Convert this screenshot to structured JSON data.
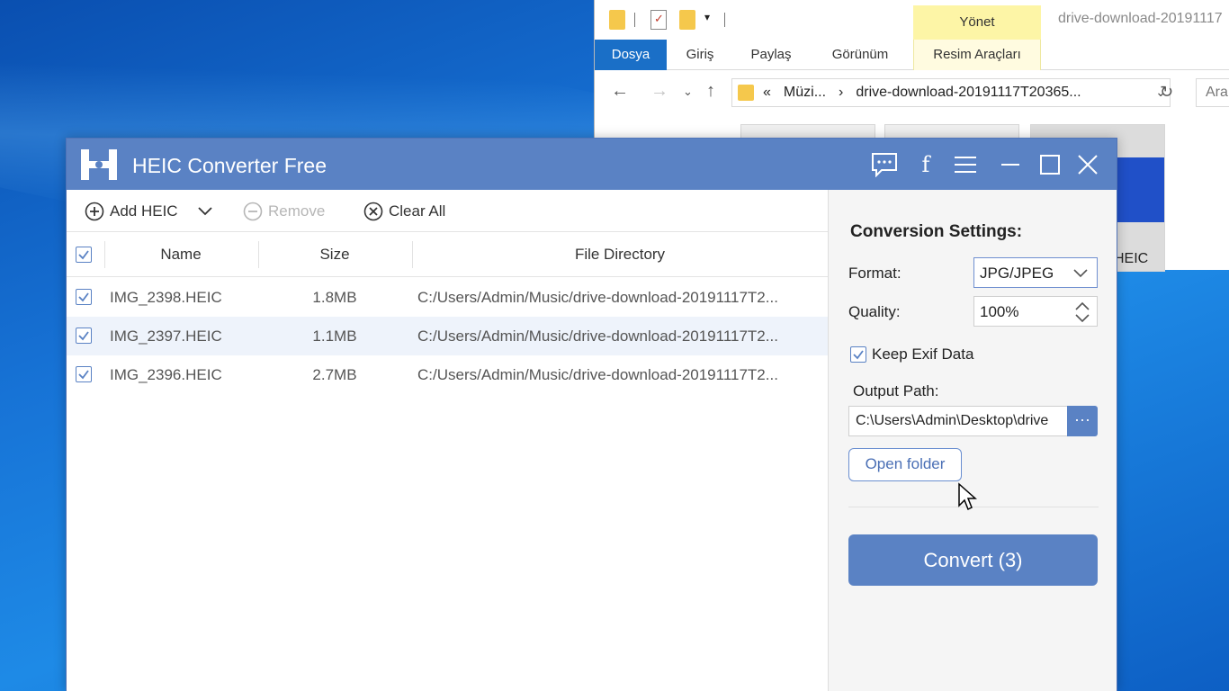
{
  "explorer": {
    "manage_tab": "Yönet",
    "title": "drive-download-20191117",
    "tabs": [
      "Dosya",
      "Giriş",
      "Paylaş",
      "Görünüm",
      "Resim Araçları"
    ],
    "address": {
      "prefix": "«",
      "segments": [
        "Müzi...",
        "›",
        "drive-download-20191117T20365..."
      ]
    },
    "search_placeholder": "Ara",
    "thumb_label": "HEIC"
  },
  "app": {
    "title": "HEIC Converter Free",
    "toolbar": {
      "add": "Add HEIC",
      "remove": "Remove",
      "clear": "Clear All"
    },
    "columns": [
      "Name",
      "Size",
      "File Directory"
    ],
    "files": [
      {
        "name": "IMG_2398.HEIC",
        "size": "1.8MB",
        "dir": "C:/Users/Admin/Music/drive-download-20191117T2...",
        "checked": true,
        "highlighted": false
      },
      {
        "name": "IMG_2397.HEIC",
        "size": "1.1MB",
        "dir": "C:/Users/Admin/Music/drive-download-20191117T2...",
        "checked": true,
        "highlighted": true
      },
      {
        "name": "IMG_2396.HEIC",
        "size": "2.7MB",
        "dir": "C:/Users/Admin/Music/drive-download-20191117T2...",
        "checked": true,
        "highlighted": false
      }
    ],
    "settings": {
      "title": "Conversion Settings:",
      "format_label": "Format:",
      "format_value": "JPG/JPEG",
      "quality_label": "Quality:",
      "quality_value": "100%",
      "exif_label": "Keep Exif Data",
      "exif_checked": true,
      "output_label": "Output Path:",
      "output_value": "C:\\Users\\Admin\\Desktop\\drive",
      "browse_label": "···",
      "open_folder": "Open folder",
      "convert": "Convert (3)"
    }
  },
  "colors": {
    "accent": "#5a82c4",
    "explorer_active_tab": "#1a6fc7",
    "manage_tab_bg": "#fdf5a6"
  }
}
